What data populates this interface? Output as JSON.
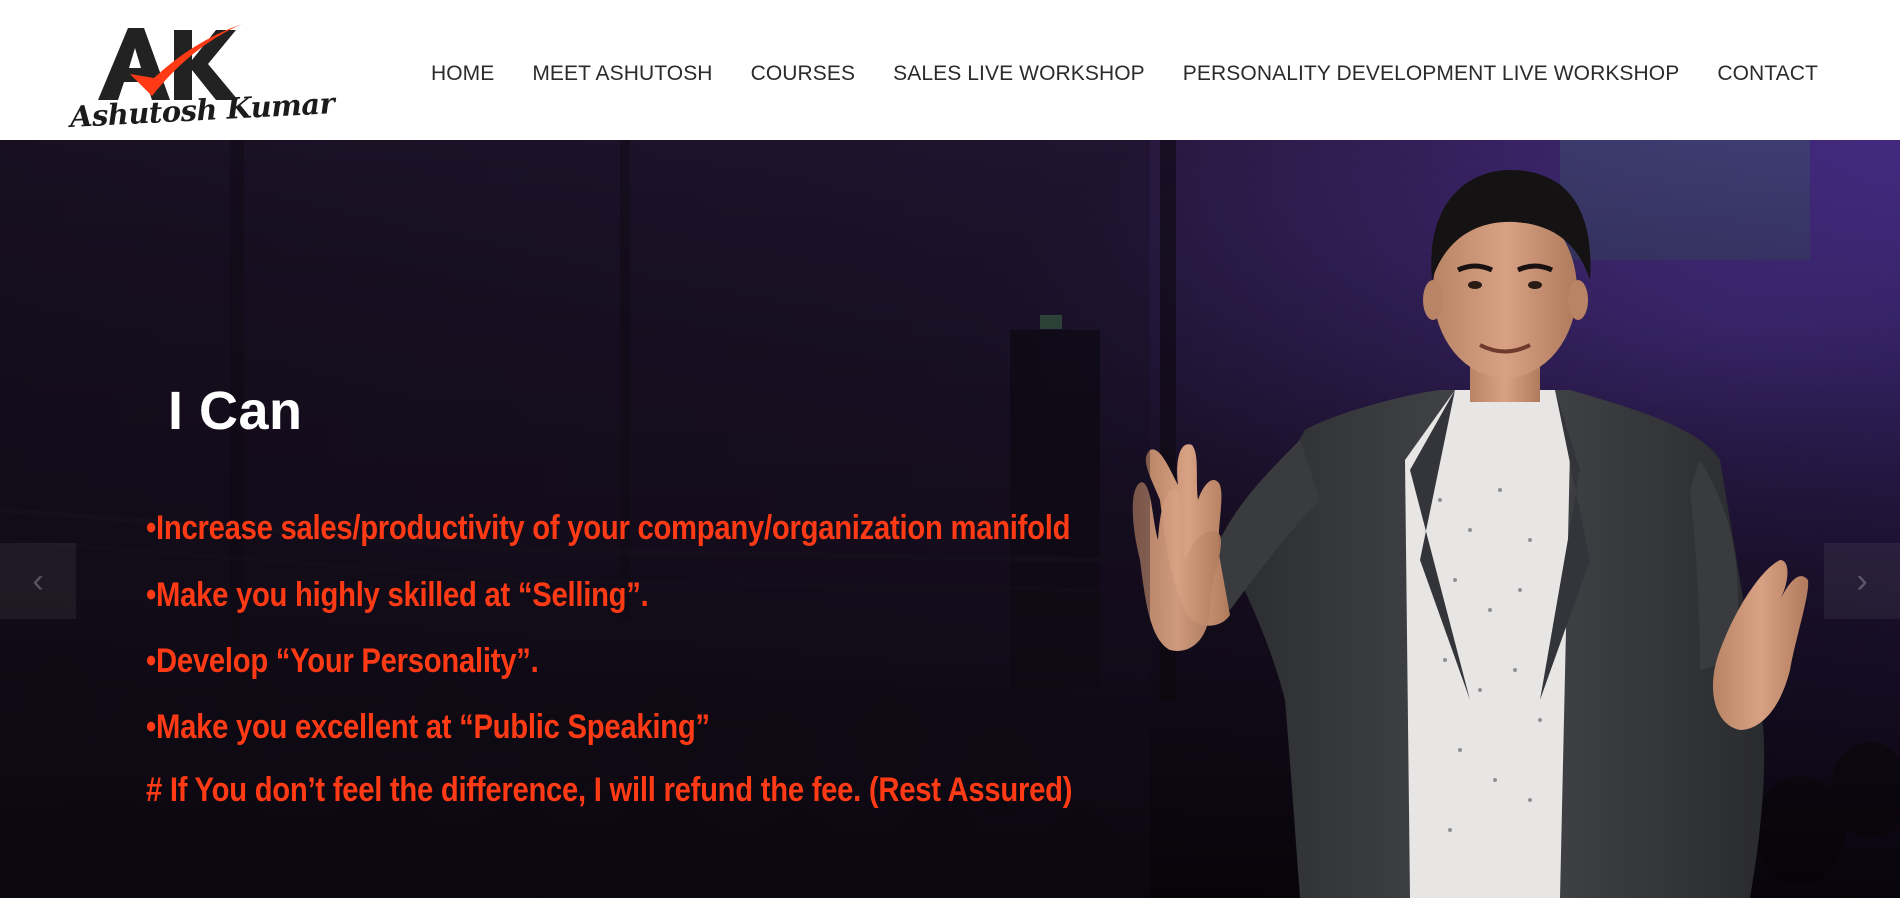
{
  "brand": {
    "logo_initials": "AK",
    "logo_script": "Ashutosh Kumar",
    "accent_color": "#ff3a14",
    "dark_color": "#222222"
  },
  "nav": {
    "items": [
      {
        "label": "HOME"
      },
      {
        "label": "MEET ASHUTOSH"
      },
      {
        "label": "COURSES"
      },
      {
        "label": "SALES LIVE WORKSHOP"
      },
      {
        "label": "PERSONALITY DEVELOPMENT LIVE WORKSHOP"
      },
      {
        "label": "CONTACT"
      }
    ]
  },
  "hero": {
    "title": "I Can",
    "bullets": [
      "•Increase sales/productivity of your company/organization manifold",
      "•Make you highly skilled at “Selling”.",
      "•Develop “Your Personality”.",
      "•Make you excellent at “Public Speaking”"
    ],
    "guarantee": "# If You don’t feel the difference, I will refund the fee. (Rest Assured)",
    "text_color": "#ff3a14",
    "overlay_color": "#2a1638"
  },
  "slider": {
    "prev_icon": "chevron-left-icon",
    "next_icon": "chevron-right-icon"
  }
}
